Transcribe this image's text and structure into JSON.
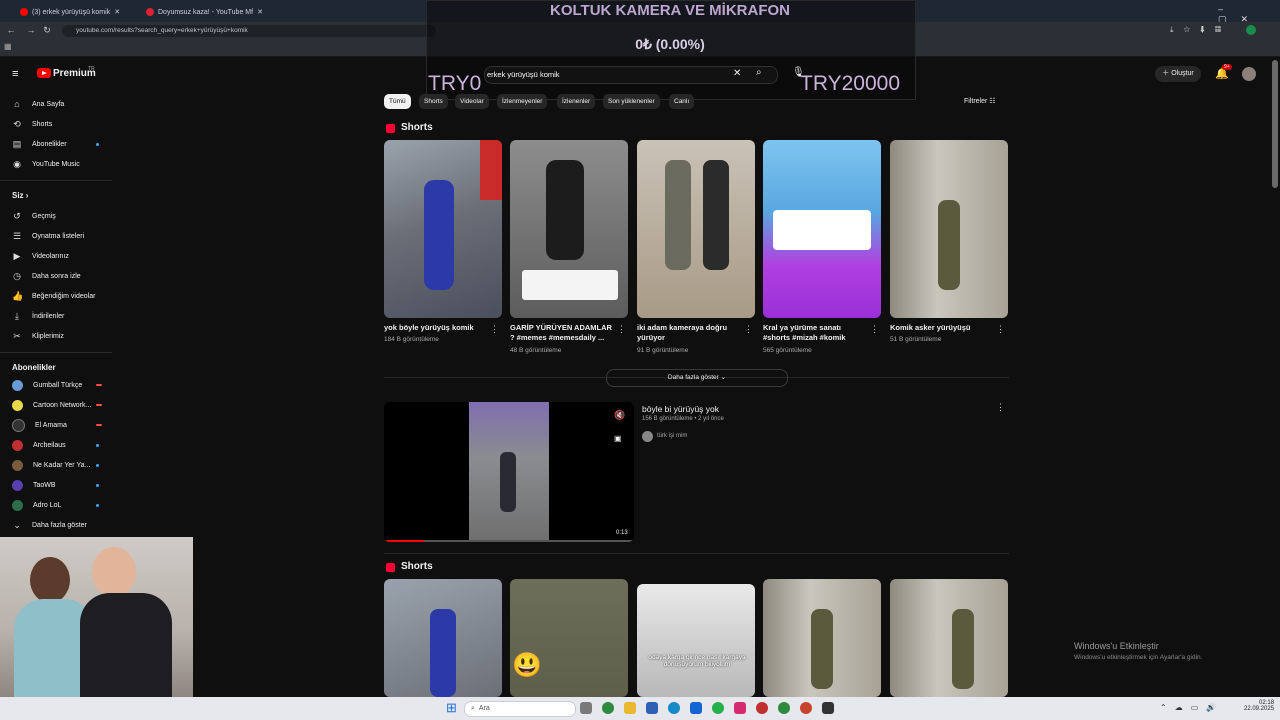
{
  "browser": {
    "tabs": [
      "(3) erkek yürüyüşü komik",
      "Doyumsuz kaza! - YouTube Mf"
    ],
    "url": "youtube.com/results?search_query=erkek+yürüyüşü+komik"
  },
  "overlay": {
    "title": "KOLTUK KAMERA VE MİKRAFON",
    "percent": "0₺ (0.00%)",
    "left_amount": "TRY0",
    "right_amount": "TRY20000"
  },
  "header": {
    "logo": "Premium",
    "logo_sup": "TR",
    "search_value": "erkek yürüyüşü komik",
    "create_label": "Oluştur",
    "notif_count": "9+"
  },
  "sidebar": {
    "main": [
      "Ana Sayfa",
      "Shorts",
      "Abonelikler",
      "YouTube Music"
    ],
    "you_heading": "Siz",
    "you_items": [
      "Geçmiş",
      "Oynatma listeleri",
      "Videolarınız",
      "Daha sonra izle",
      "Beğendiğim videolar",
      "İndirilenler",
      "Kliplerimiz"
    ],
    "subs_heading": "Abonelikler",
    "subs": [
      "Gumball Türkçe",
      "Cartoon Network...",
      "El Amama",
      "Archeilaus",
      "Ne Kadar Yer Ya...",
      "TaoWB",
      "Adro LoL"
    ],
    "show_more": "Daha fazla göster"
  },
  "chips": [
    "Tümü",
    "Shorts",
    "Videolar",
    "İzlenmeyenler",
    "İzlenenler",
    "Son yüklenenler",
    "Canlı"
  ],
  "filters_label": "Filtreler",
  "shorts1": {
    "title": "Shorts",
    "items": [
      {
        "title": "yok böyle yürüyüş komik",
        "views": "184 B görüntüleme"
      },
      {
        "title": "GARİP YÜRÜYEN ADAMLAR ? #memes #memesdaily ...",
        "views": "48 B görüntüleme"
      },
      {
        "title": "iki adam kameraya doğru yürüyor",
        "views": "91 B görüntüleme"
      },
      {
        "title": "Kral ya yürüme sanatı #shorts #mizah #komik",
        "views": "565 görüntüleme"
      },
      {
        "title": "Komik asker yürüyüşü",
        "views": "51 B görüntüleme"
      }
    ]
  },
  "show_more_label": "Daha fazla göster",
  "video": {
    "title": "böyle bi yürüyüş yok",
    "meta": "156 B görüntüleme • 2 yıl önce",
    "channel": "türk işi mim",
    "duration": "0:13"
  },
  "shorts2": {
    "title": "Shorts",
    "overlay_text": "odaya karga girince nasıl kargaya dönüşüyorum biliyolum"
  },
  "windows_watermark": {
    "title": "Windows'u Etkinleştir",
    "sub": "Windows'u etkinleştirmek için Ayarlar'a gidin."
  },
  "taskbar": {
    "search": "Ara",
    "time": "02:18",
    "date": "22.09.2025"
  },
  "colors": {
    "brand": "#ff0000",
    "bg": "#0f0f0f",
    "accent": "#3ea6ff"
  }
}
